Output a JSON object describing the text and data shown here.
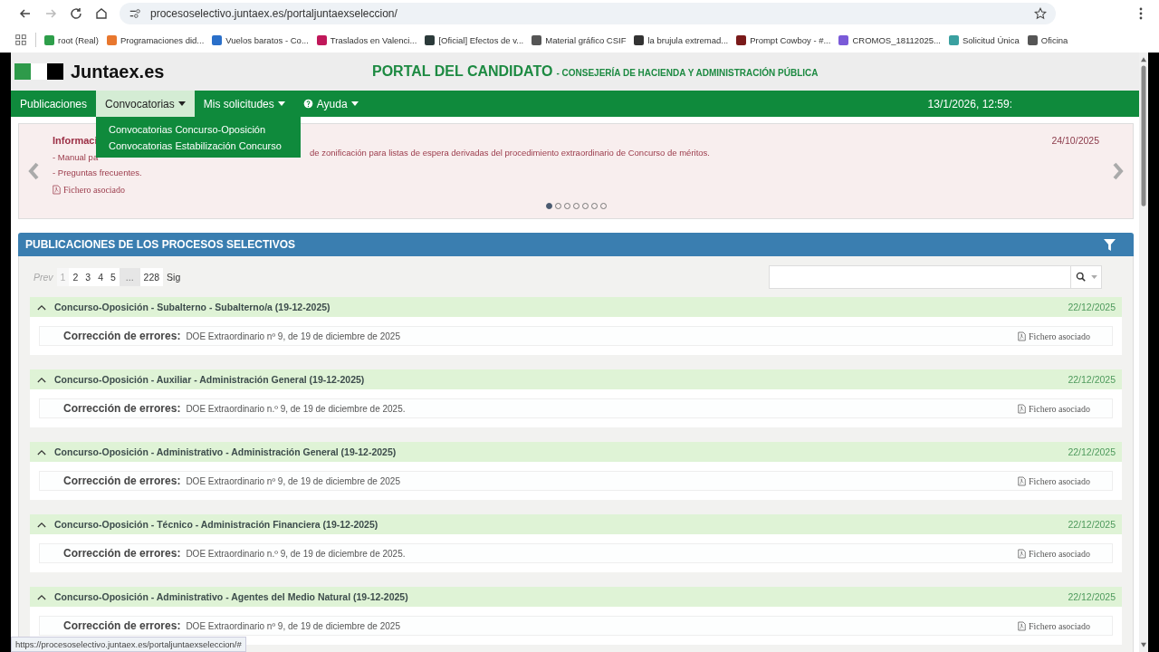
{
  "browser": {
    "url": "procesoselectivo.juntaex.es/portaljuntaexseleccion/",
    "forward_disabled": true,
    "bookmarks": [
      {
        "label": "root (Real)",
        "color": "#2e9e4a"
      },
      {
        "label": "Programaciones did...",
        "color": "#e8772e"
      },
      {
        "label": "Vuelos baratos - Co...",
        "color": "#2a6fc9"
      },
      {
        "label": "Traslados en Valenci...",
        "color": "#c0185a"
      },
      {
        "label": "[Oficial] Efectos de v...",
        "color": "#2b3a3a"
      },
      {
        "label": "Material gráfico CSIF",
        "color": "#555555"
      },
      {
        "label": "la brujula extremad...",
        "color": "#333333"
      },
      {
        "label": "Prompt Cowboy - #...",
        "color": "#7a1a1a"
      },
      {
        "label": "CROMOS_18112025...",
        "color": "#7a5ad8"
      },
      {
        "label": "Solicitud Única",
        "color": "#3aa0a0"
      },
      {
        "label": "Oficina",
        "color": "#555555"
      }
    ],
    "status_url": "https://procesoselectivo.juntaex.es/portaljuntaexseleccion/#"
  },
  "header": {
    "logo": "Juntaex.es",
    "portal_title": "PORTAL DEL CANDIDATO",
    "portal_subtitle": "- CONSEJERÍA DE HACIENDA Y ADMINISTRACIÓN PÚBLICA"
  },
  "nav": {
    "items": [
      {
        "label": "Publicaciones",
        "kind": "plain",
        "selected": false
      },
      {
        "label": "Convocatorias",
        "kind": "dropdown",
        "selected": true
      },
      {
        "label": "Mis solicitudes",
        "kind": "dropdown",
        "selected": false
      },
      {
        "label": "Ayuda",
        "kind": "help",
        "selected": false
      }
    ],
    "datetime": "13/1/2026, 12:59:",
    "open_menu": [
      "Convocatorias Concurso-Oposición",
      "Convocatorias Estabilización Concurso"
    ]
  },
  "carousel": {
    "title": "Informaci",
    "date": "24/10/2025",
    "line_1_start": "- Manual pa",
    "line_1_end": "de zonificación para listas de espera derivadas del procedimiento extraordinario de Concurso de méritos.",
    "line_2": "- Preguntas frecuentes.",
    "file_link": "Fichero asociado",
    "indicators": [
      {
        "selected": true
      },
      {
        "selected": false
      },
      {
        "selected": false
      },
      {
        "selected": false
      },
      {
        "selected": false
      },
      {
        "selected": false
      },
      {
        "selected": false
      }
    ]
  },
  "panel": {
    "title": "PUBLICACIONES DE LOS PROCESOS SELECTIVOS",
    "pagination": [
      {
        "label": "Prev",
        "kind": "prev",
        "disabled": true
      },
      {
        "label": "1",
        "kind": "page",
        "disabled": false,
        "selected": true
      },
      {
        "label": "2",
        "kind": "page",
        "disabled": false,
        "selected": false
      },
      {
        "label": "3",
        "kind": "page",
        "disabled": false,
        "selected": false
      },
      {
        "label": "4",
        "kind": "page",
        "disabled": false,
        "selected": false
      },
      {
        "label": "5",
        "kind": "page",
        "disabled": false,
        "selected": false
      },
      {
        "label": "...",
        "kind": "ellipsis",
        "disabled": false
      },
      {
        "label": "228",
        "kind": "page",
        "disabled": false,
        "selected": false
      },
      {
        "label": "Sig",
        "kind": "next",
        "disabled": false
      }
    ],
    "publications": [
      {
        "title": "Concurso-Oposición - Subalterno - Subalterno/a (19-12-2025)",
        "date": "22/12/2025",
        "expanded": true,
        "label": "Corrección de errores:",
        "text": "DOE Extraordinario nº 9, de 19 de diciembre de 2025",
        "file_link": "Fichero asociado"
      },
      {
        "title": "Concurso-Oposición - Auxiliar - Administración General (19-12-2025)",
        "date": "22/12/2025",
        "expanded": true,
        "label": "Corrección de errores:",
        "text": "DOE Extraordinario n.º 9, de 19 de diciembre de 2025.",
        "file_link": "Fichero asociado"
      },
      {
        "title": "Concurso-Oposición - Administrativo - Administración General (19-12-2025)",
        "date": "22/12/2025",
        "expanded": true,
        "label": "Corrección de errores:",
        "text": "DOE Extraordinario nº 9, de 19 de diciembre de 2025",
        "file_link": "Fichero asociado"
      },
      {
        "title": "Concurso-Oposición - Técnico - Administración Financiera (19-12-2025)",
        "date": "22/12/2025",
        "expanded": true,
        "label": "Corrección de errores:",
        "text": "DOE Extraordinario n.º 9, de 19 de diciembre de 2025.",
        "file_link": "Fichero asociado"
      },
      {
        "title": "Concurso-Oposición - Administrativo - Agentes del Medio Natural (19-12-2025)",
        "date": "22/12/2025",
        "expanded": true,
        "label": "Corrección de errores:",
        "text": "DOE Extraordinario nº 9, de 19 de diciembre de 2025",
        "file_link": "Fichero asociado"
      }
    ]
  }
}
